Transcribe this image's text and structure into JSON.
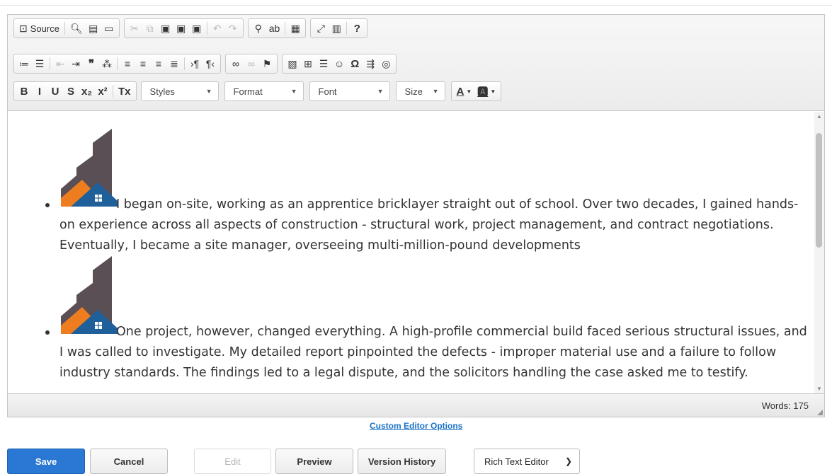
{
  "toolbar": {
    "row1": [
      {
        "type": "group",
        "items": [
          {
            "name": "source-button",
            "icon": "source-icon",
            "glyph": "⊡",
            "label": "Source"
          },
          {
            "sep": true
          },
          {
            "name": "preview-button",
            "icon": "preview-icon",
            "glyph": "🔍︎"
          },
          {
            "name": "print-button",
            "icon": "print-icon",
            "glyph": "▤"
          },
          {
            "name": "templates-button",
            "icon": "templates-icon",
            "glyph": "▭"
          }
        ]
      },
      {
        "type": "group",
        "items": [
          {
            "name": "cut-button",
            "icon": "cut-icon",
            "glyph": "✂",
            "disabled": true
          },
          {
            "name": "copy-button",
            "icon": "copy-icon",
            "glyph": "⧉",
            "disabled": true
          },
          {
            "name": "paste-button",
            "icon": "paste-icon",
            "glyph": "▣"
          },
          {
            "name": "paste-text-button",
            "icon": "paste-text-icon",
            "glyph": "▣"
          },
          {
            "name": "paste-word-button",
            "icon": "paste-word-icon",
            "glyph": "▣"
          },
          {
            "sep": true
          },
          {
            "name": "undo-button",
            "icon": "undo-icon",
            "glyph": "↶",
            "disabled": true
          },
          {
            "name": "redo-button",
            "icon": "redo-icon",
            "glyph": "↷",
            "disabled": true
          }
        ]
      },
      {
        "type": "group",
        "items": [
          {
            "name": "find-button",
            "icon": "find-icon",
            "glyph": "⚲"
          },
          {
            "name": "replace-button",
            "icon": "replace-icon",
            "glyph": "ab"
          },
          {
            "sep": true
          },
          {
            "name": "select-all-button",
            "icon": "select-all-icon",
            "glyph": "▦"
          }
        ]
      },
      {
        "type": "group",
        "items": [
          {
            "name": "maximize-button",
            "icon": "maximize-icon",
            "glyph": "⤢"
          },
          {
            "name": "show-blocks-button",
            "icon": "show-blocks-icon",
            "glyph": "▥"
          },
          {
            "sep": true
          },
          {
            "name": "help-button",
            "icon": "help-icon",
            "glyph": "?",
            "bold": true
          }
        ]
      }
    ],
    "row2": [
      {
        "type": "group",
        "items": [
          {
            "name": "numbered-list-button",
            "icon": "numbered-list-icon",
            "glyph": "≔"
          },
          {
            "name": "bulleted-list-button",
            "icon": "bulleted-list-icon",
            "glyph": "☰"
          },
          {
            "sep": true
          },
          {
            "name": "outdent-button",
            "icon": "outdent-icon",
            "glyph": "⇤",
            "disabled": true
          },
          {
            "name": "indent-button",
            "icon": "indent-icon",
            "glyph": "⇥"
          },
          {
            "name": "blockquote-button",
            "icon": "blockquote-icon",
            "glyph": "❞",
            "bold": true
          },
          {
            "name": "create-div-button",
            "icon": "div-icon",
            "glyph": "⁂"
          },
          {
            "sep": true
          },
          {
            "name": "align-left-button",
            "icon": "align-left-icon",
            "glyph": "≡"
          },
          {
            "name": "align-center-button",
            "icon": "align-center-icon",
            "glyph": "≡"
          },
          {
            "name": "align-right-button",
            "icon": "align-right-icon",
            "glyph": "≡"
          },
          {
            "name": "justify-button",
            "icon": "justify-icon",
            "glyph": "≣"
          },
          {
            "sep": true
          },
          {
            "name": "ltr-button",
            "icon": "text-direction-ltr-icon",
            "glyph": "›¶"
          },
          {
            "name": "rtl-button",
            "icon": "text-direction-rtl-icon",
            "glyph": "¶‹"
          }
        ]
      },
      {
        "type": "group",
        "items": [
          {
            "name": "link-button",
            "icon": "link-icon",
            "glyph": "∞"
          },
          {
            "name": "unlink-button",
            "icon": "unlink-icon",
            "glyph": "∞",
            "disabled": true
          },
          {
            "name": "anchor-button",
            "icon": "anchor-flag-icon",
            "glyph": "⚑"
          }
        ]
      },
      {
        "type": "group",
        "items": [
          {
            "name": "image-button",
            "icon": "image-icon",
            "glyph": "▨"
          },
          {
            "name": "table-button",
            "icon": "table-icon",
            "glyph": "⊞"
          },
          {
            "name": "horizontal-line-button",
            "icon": "horizontal-line-icon",
            "glyph": "☰"
          },
          {
            "name": "smiley-button",
            "icon": "smiley-icon",
            "glyph": "☺"
          },
          {
            "name": "special-char-button",
            "icon": "omega-icon",
            "glyph": "Ω",
            "bold": true
          },
          {
            "name": "page-break-button",
            "icon": "page-break-icon",
            "glyph": "⇶"
          },
          {
            "name": "iframe-button",
            "icon": "globe-icon",
            "glyph": "◎"
          }
        ]
      }
    ],
    "row3_format": [
      {
        "name": "bold-button",
        "icon": "bold-icon",
        "glyph": "B",
        "bold": true
      },
      {
        "name": "italic-button",
        "icon": "italic-icon",
        "glyph": "I",
        "bold": true
      },
      {
        "name": "underline-button",
        "icon": "underline-icon",
        "glyph": "U",
        "bold": true
      },
      {
        "name": "strikethrough-button",
        "icon": "strikethrough-icon",
        "glyph": "S",
        "bold": true
      },
      {
        "name": "subscript-button",
        "icon": "subscript-icon",
        "glyph": "x₂",
        "bold": true
      },
      {
        "name": "superscript-button",
        "icon": "superscript-icon",
        "glyph": "x²",
        "bold": true
      },
      {
        "sep": true
      },
      {
        "name": "remove-format-button",
        "icon": "remove-format-icon",
        "glyph": "Tx",
        "bold": true
      }
    ],
    "combos": [
      {
        "name": "styles-combo",
        "label": "Styles",
        "width": 110
      },
      {
        "name": "format-combo",
        "label": "Format",
        "width": 112
      },
      {
        "name": "font-combo",
        "label": "Font",
        "width": 114
      },
      {
        "name": "size-combo",
        "label": "Size",
        "width": 70
      }
    ],
    "color_buttons": [
      {
        "name": "text-color-button",
        "icon": "text-color-icon",
        "glyph": "A"
      },
      {
        "name": "background-color-button",
        "icon": "background-color-icon",
        "glyph": "🅰"
      }
    ]
  },
  "content": {
    "paragraphs": [
      "I began on-site, working as an apprentice bricklayer straight out of school. Over two decades, I gained hands-on experience across all aspects of construction - structural work, project management, and contract negotiations. Eventually, I became a site manager, overseeing multi-million-pound developments",
      "One project, however, changed everything. A high-profile commercial build faced serious structural issues, and I was called to investigate. My detailed report pinpointed the defects - improper material use and a failure to follow industry standards. The findings led to a legal dispute, and the solicitors handling the case asked me to testify."
    ],
    "logo_icon": "house-building-logo-icon"
  },
  "status": {
    "word_count": "Words: 175"
  },
  "links": {
    "custom_editor_options": "Custom Editor Options"
  },
  "buttons": {
    "save": "Save",
    "cancel": "Cancel",
    "edit": "Edit",
    "preview": "Preview",
    "version_history": "Version History"
  },
  "editor_select": {
    "selected": "Rich Text Editor"
  },
  "colors": {
    "accent_blue": "#2a78d3",
    "logo_grey": "#5a4f55",
    "logo_orange": "#ee7d1f",
    "logo_blue": "#1f5f9a"
  }
}
